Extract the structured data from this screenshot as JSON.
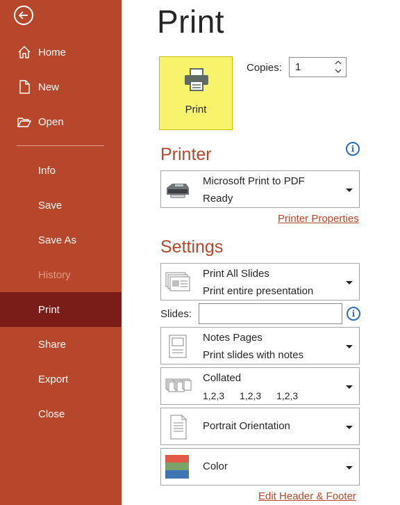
{
  "sidebar": {
    "items": [
      {
        "label": "Home"
      },
      {
        "label": "New"
      },
      {
        "label": "Open"
      },
      {
        "label": "Info"
      },
      {
        "label": "Save"
      },
      {
        "label": "Save As"
      },
      {
        "label": "History"
      },
      {
        "label": "Print"
      },
      {
        "label": "Share"
      },
      {
        "label": "Export"
      },
      {
        "label": "Close"
      }
    ],
    "active_item": "Print",
    "disabled_item": "History"
  },
  "main": {
    "title": "Print",
    "print_button_label": "Print",
    "copies_label": "Copies:",
    "copies_value": "1",
    "printer": {
      "heading": "Printer",
      "name": "Microsoft Print to PDF",
      "status": "Ready",
      "properties_link": "Printer Properties"
    },
    "settings": {
      "heading": "Settings",
      "range": {
        "title": "Print All Slides",
        "subtitle": "Print entire presentation"
      },
      "slides_label": "Slides:",
      "slides_value": "",
      "layout": {
        "title": "Notes Pages",
        "subtitle": "Print slides with notes"
      },
      "collation": {
        "title": "Collated",
        "sequence": [
          "1,2,3",
          "1,2,3",
          "1,2,3"
        ]
      },
      "orientation": {
        "title": "Portrait Orientation"
      },
      "color": {
        "title": "Color"
      },
      "header_footer_link": "Edit Header & Footer"
    }
  },
  "colors": {
    "accent": "#b7472a",
    "active_nav": "#7a1d18",
    "print_highlight": "#f7f36a",
    "info_blue": "#2b6cc4"
  },
  "icons": {
    "back": "back-arrow-icon",
    "home": "home-icon",
    "new": "new-document-icon",
    "open": "folder-open-icon",
    "printer": "printer-icon",
    "info": "info-icon"
  }
}
